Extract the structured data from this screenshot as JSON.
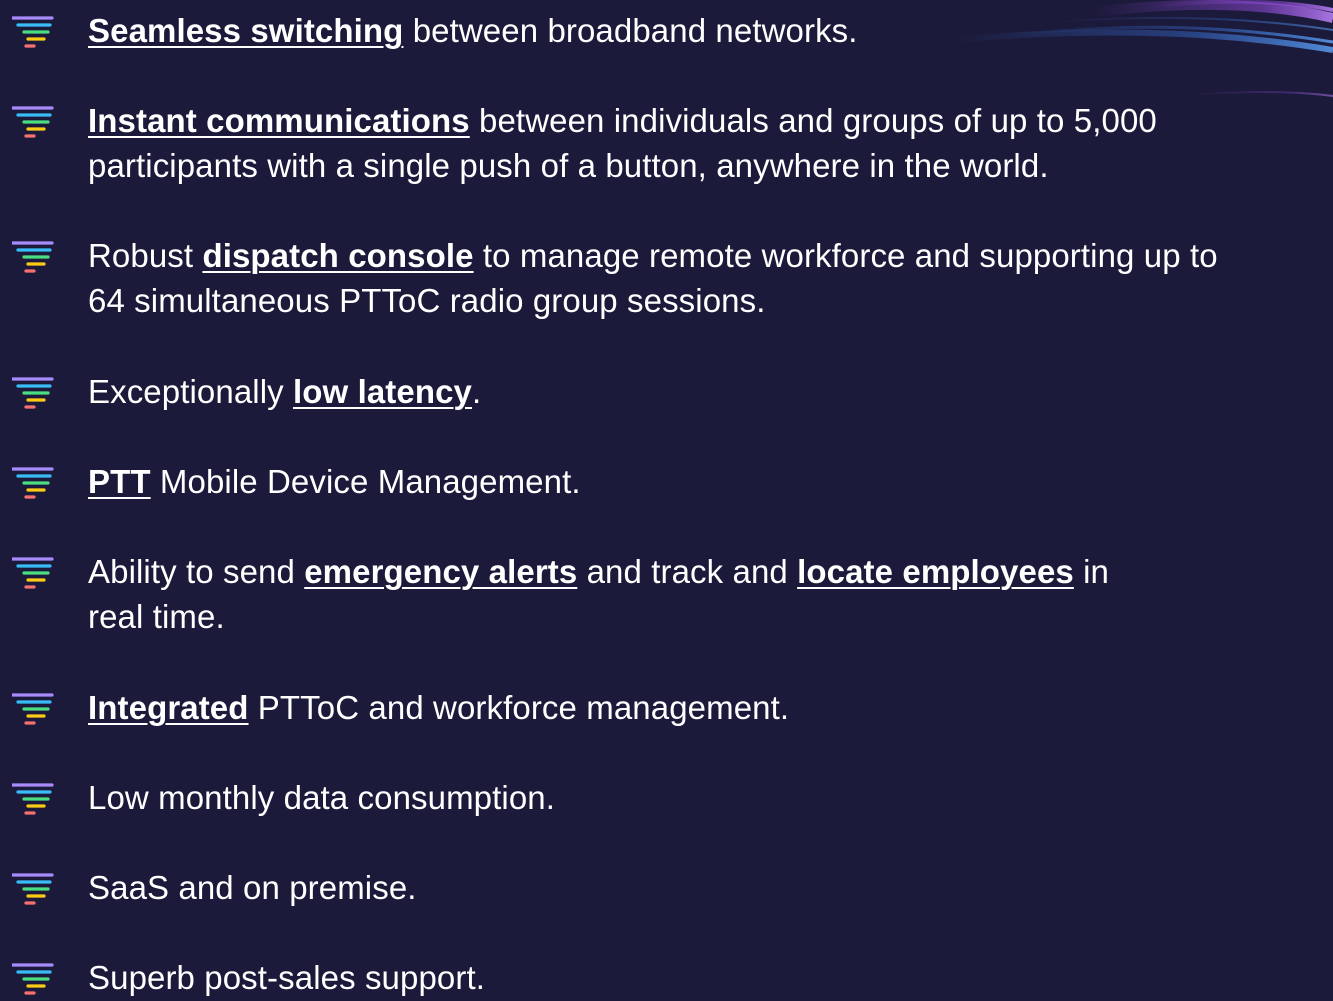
{
  "features": [
    {
      "parts": [
        {
          "text": "Seamless switching",
          "link": true
        },
        {
          "text": " between broadband networks.",
          "link": false
        }
      ]
    },
    {
      "parts": [
        {
          "text": "Instant communications",
          "link": true
        },
        {
          "text": " between individuals and groups of up to 5,000",
          "link": false
        },
        {
          "text": "participants with a single push of a button, anywhere in the world.",
          "link": false,
          "newline": true
        }
      ]
    },
    {
      "parts": [
        {
          "text": "Robust ",
          "link": false
        },
        {
          "text": "dispatch console",
          "link": true
        },
        {
          "text": " to manage remote workforce and supporting up to",
          "link": false
        },
        {
          "text": "64 simultaneous PTToC radio group sessions.",
          "link": false,
          "newline": true
        }
      ]
    },
    {
      "parts": [
        {
          "text": "Exceptionally ",
          "link": false
        },
        {
          "text": "low latency",
          "link": true
        },
        {
          "text": ".",
          "link": false
        }
      ]
    },
    {
      "parts": [
        {
          "text": "PTT",
          "link": true
        },
        {
          "text": " Mobile Device Management.",
          "link": false
        }
      ]
    },
    {
      "parts": [
        {
          "text": "Ability to send ",
          "link": false
        },
        {
          "text": "emergency alerts",
          "link": true
        },
        {
          "text": " and track and ",
          "link": false
        },
        {
          "text": "locate employees",
          "link": true
        },
        {
          "text": " in",
          "link": false
        },
        {
          "text": "real time.",
          "link": false,
          "newline": true
        }
      ]
    },
    {
      "parts": [
        {
          "text": "Integrated",
          "link": true
        },
        {
          "text": " PTToC and workforce management.",
          "link": false
        }
      ]
    },
    {
      "parts": [
        {
          "text": "Low monthly data consumption.",
          "link": false
        }
      ]
    },
    {
      "parts": [
        {
          "text": "SaaS and on premise.",
          "link": false
        }
      ]
    },
    {
      "parts": [
        {
          "text": "Superb post-sales support.",
          "link": false
        }
      ]
    }
  ],
  "icon": {
    "name": "feature-list-icon",
    "colors": [
      "#a78bfa",
      "#38bdf8",
      "#4ade80",
      "#facc15",
      "#f87171"
    ]
  },
  "colors": {
    "background": "#1c1a3b",
    "text": "#ffffff",
    "swoosh_primary": "#3b82f6",
    "swoosh_secondary": "#a855f7"
  }
}
